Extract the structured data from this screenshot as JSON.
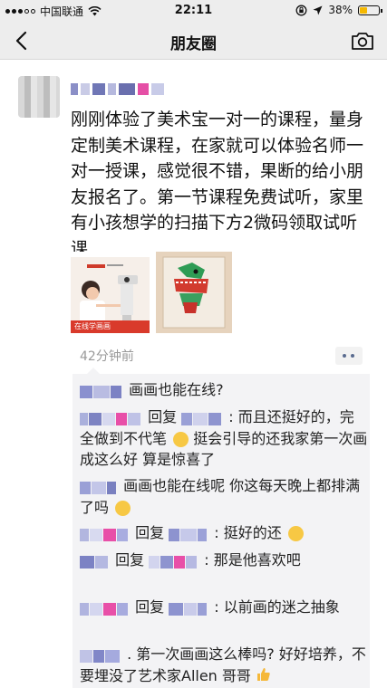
{
  "status_bar": {
    "carrier": "中国联通",
    "time": "22:11",
    "battery": "38%",
    "battery_level": 0.38
  },
  "nav": {
    "title": "朋友圈"
  },
  "post": {
    "text": "刚刚体验了美术宝一对一的课程，量身定制美术课程，在家就可以体验名师一对一授课，感觉很不错，果断的给小朋友报名了。第一节课程免费试听，家里有小孩想学的扫描下方2微码领取试听课",
    "image1_caption": "在线学画画",
    "time": "42分钟前"
  },
  "comments": [
    {
      "type": "plain",
      "text": "画画也能在线?"
    },
    {
      "type": "reply",
      "reply_word": "回复",
      "text": ": 而且还挺好的，完全做到不代笔",
      "text2": "挺会引导的还我家第一次画成这么好 算是惊喜了"
    },
    {
      "type": "plain",
      "text": "画画也能在线呢 你这每天晚上都排满了吗"
    },
    {
      "type": "reply",
      "reply_word": "回复",
      "text": ": 挺好的还"
    },
    {
      "type": "reply",
      "reply_word": "回复",
      "text": ": 那是他喜欢吧"
    },
    {
      "type": "reply",
      "reply_word": "回复",
      "text": ": 以前画的迷之抽象"
    },
    {
      "type": "plain",
      "text": ". 第一次画画这么棒吗? 好好培养，不要埋没了艺术家Allen 哥哥"
    }
  ],
  "icons": {
    "back": "chevron-left-icon",
    "camera": "camera-icon",
    "wifi": "wifi-icon",
    "location": "location-arrow-icon",
    "lock_rotation": "rotation-lock-icon"
  },
  "colors": {
    "bar_bg": "#ededed",
    "comment_bg": "#f3f3f5",
    "pixel_pink": "#e84fa8",
    "pixel_blue": "#8a8fd6"
  }
}
